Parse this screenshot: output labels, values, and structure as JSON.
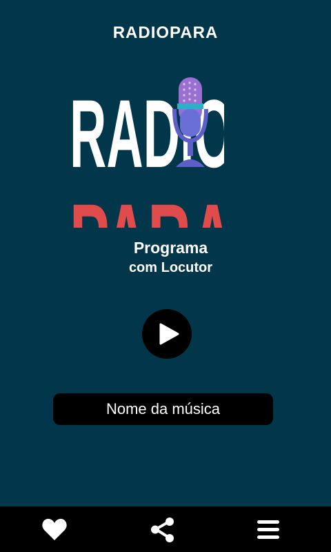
{
  "header": {
    "title": "RADIOPARA"
  },
  "logo": {
    "text_top": "RADIO",
    "text_bottom": "PARA",
    "colors": {
      "white": "#ffffff",
      "red": "#e04c4c",
      "mic": "#5b5fc7",
      "mic_dots": "#9b6fd1"
    }
  },
  "program": {
    "title": "Programa",
    "subtitle": "com Locutor"
  },
  "player": {
    "play_icon": "play-icon"
  },
  "song": {
    "name": "Nome da música"
  },
  "bottom_nav": {
    "items": [
      {
        "icon": "heart-icon"
      },
      {
        "icon": "share-icon"
      },
      {
        "icon": "menu-icon"
      }
    ]
  },
  "colors": {
    "background": "#02364a",
    "bar": "#000000",
    "text": "#ffffff"
  }
}
